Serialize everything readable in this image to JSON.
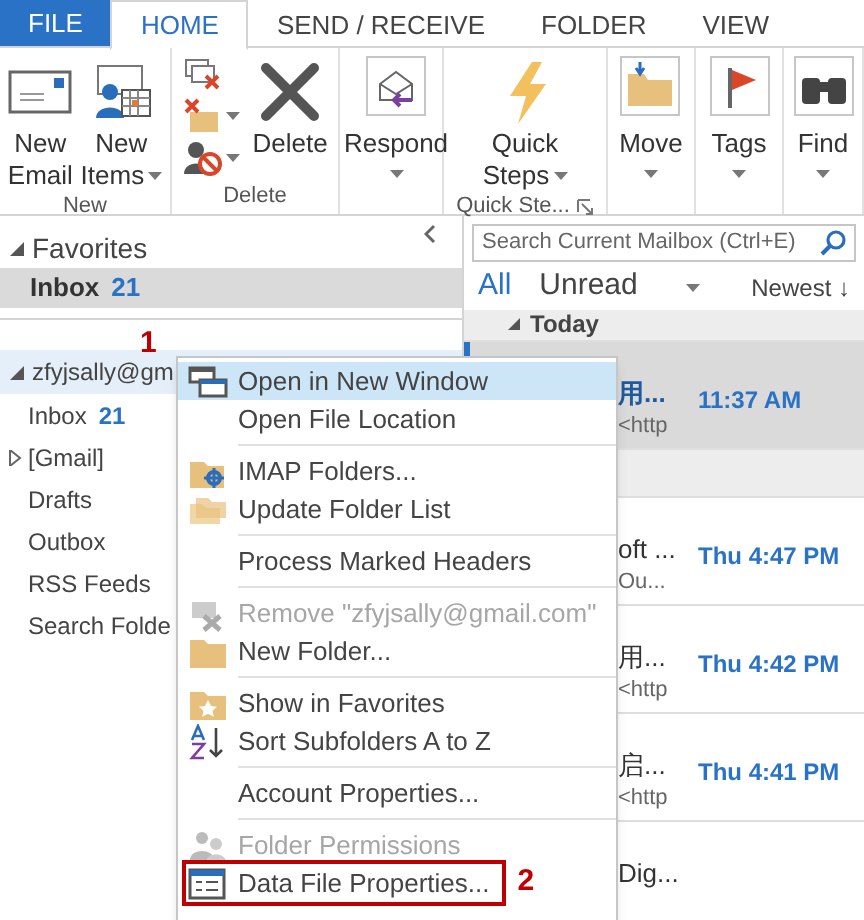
{
  "ribbon_tabs": [
    {
      "label": "FILE",
      "kind": "file",
      "selected": false
    },
    {
      "label": "HOME",
      "kind": "tab",
      "selected": true
    },
    {
      "label": "SEND / RECEIVE",
      "kind": "tab",
      "selected": false
    },
    {
      "label": "FOLDER",
      "kind": "tab",
      "selected": false
    },
    {
      "label": "VIEW",
      "kind": "tab",
      "selected": false
    }
  ],
  "ribbon_groups": [
    {
      "label": "New",
      "buttons": [
        {
          "kind": "large",
          "lines": [
            "New",
            "Email"
          ],
          "dropdown": false
        },
        {
          "kind": "large",
          "lines": [
            "New",
            "Items"
          ],
          "dropdown": true
        }
      ]
    },
    {
      "label": "Delete",
      "buttons": [
        {
          "kind": "small-stack",
          "items": [
            {
              "dropdown": false
            },
            {
              "dropdown": true
            },
            {
              "dropdown": true
            }
          ]
        },
        {
          "kind": "large",
          "lines": [
            "Delete"
          ],
          "dropdown": false
        }
      ]
    },
    {
      "buttons": [
        {
          "kind": "boxed",
          "lines": [
            "Respond"
          ],
          "dropdown": true
        }
      ]
    },
    {
      "label": "Quick Ste...",
      "launcher": true,
      "buttons": [
        {
          "kind": "large",
          "lines": [
            "Quick",
            "Steps"
          ],
          "dropdown": true
        }
      ]
    },
    {
      "buttons": [
        {
          "kind": "boxed",
          "lines": [
            "Move"
          ],
          "dropdown": true
        }
      ]
    },
    {
      "buttons": [
        {
          "kind": "boxed",
          "lines": [
            "Tags"
          ],
          "dropdown": true
        }
      ]
    },
    {
      "buttons": [
        {
          "kind": "boxed",
          "lines": [
            "Find"
          ],
          "dropdown": true
        }
      ]
    }
  ],
  "folder_pane": {
    "favorites": {
      "label": "Favorites",
      "expanded": true,
      "items": [
        {
          "name": "Inbox",
          "count": "21",
          "selected": true
        }
      ]
    },
    "step_marker": "1",
    "account": {
      "label": "zfyjsally@gm",
      "expanded": true,
      "selected": true
    },
    "folders": [
      {
        "name": "Inbox",
        "count": "21",
        "expandable": false
      },
      {
        "name": "[Gmail]",
        "expandable": true
      },
      {
        "name": "Drafts",
        "expandable": false
      },
      {
        "name": "Outbox",
        "expandable": false
      },
      {
        "name": "RSS Feeds",
        "expandable": false
      },
      {
        "name": "Search Folde",
        "expandable": false
      }
    ]
  },
  "message_list": {
    "search": {
      "placeholder": "Search Current Mailbox (Ctrl+E)"
    },
    "filters": [
      {
        "label": "All",
        "selected": true
      },
      {
        "label": "Unread",
        "selected": false
      }
    ],
    "sort": "Newest ↓",
    "items": [
      {
        "kind": "header",
        "label": "Today"
      },
      {
        "kind": "message",
        "line_1": "用...",
        "line_2": "<http",
        "time": "11:37 AM",
        "selected": true,
        "unread": true
      },
      {
        "kind": "header"
      },
      {
        "kind": "message",
        "line_1": "oft ...",
        "line_2": "Ou...",
        "time": "Thu 4:47 PM",
        "selected": false,
        "unread": false
      },
      {
        "kind": "message",
        "line_1": "用...",
        "line_2": "<http",
        "time": "Thu 4:42 PM",
        "selected": false,
        "unread": false
      },
      {
        "kind": "message",
        "line_1": "启...",
        "line_2": "<http",
        "time": "Thu 4:41 PM",
        "selected": false,
        "unread": false
      },
      {
        "kind": "message",
        "line_1": "Dig...",
        "selected": false,
        "unread": false
      }
    ]
  },
  "context_menu": [
    {
      "kind": "item",
      "label": "Open in New Window",
      "disabled": false,
      "selected": true
    },
    {
      "kind": "item",
      "label": "Open File Location",
      "disabled": false,
      "selected": false
    },
    {
      "kind": "separator"
    },
    {
      "kind": "item",
      "label": "IMAP Folders...",
      "disabled": false,
      "selected": false
    },
    {
      "kind": "item",
      "label": "Update Folder List",
      "disabled": false,
      "selected": false
    },
    {
      "kind": "separator"
    },
    {
      "kind": "item",
      "label": "Process Marked Headers",
      "disabled": false,
      "selected": false
    },
    {
      "kind": "separator"
    },
    {
      "kind": "item",
      "label": "Remove \"zfyjsally@gmail.com\"",
      "disabled": true,
      "selected": false
    },
    {
      "kind": "item",
      "label": "New Folder...",
      "disabled": false,
      "selected": false
    },
    {
      "kind": "separator"
    },
    {
      "kind": "item",
      "label": "Show in Favorites",
      "disabled": false,
      "selected": false
    },
    {
      "kind": "item",
      "label": "Sort Subfolders A to Z",
      "disabled": false,
      "selected": false
    },
    {
      "kind": "separator"
    },
    {
      "kind": "item",
      "label": "Account Properties...",
      "disabled": false,
      "selected": false
    },
    {
      "kind": "separator"
    },
    {
      "kind": "item",
      "label": "Folder Permissions",
      "disabled": true,
      "selected": false
    },
    {
      "kind": "item",
      "label": "Data File Properties...",
      "disabled": false,
      "selected": false,
      "highlighted": true,
      "step_marker": "2"
    }
  ]
}
